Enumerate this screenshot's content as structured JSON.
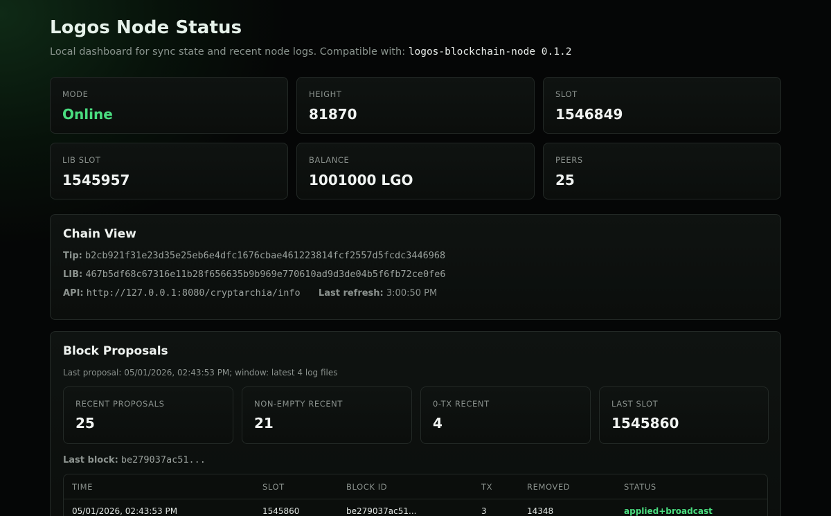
{
  "header": {
    "title": "Logos Node Status",
    "subtitle_text": "Local dashboard for sync state and recent node logs. Compatible with:",
    "compat_version": "logos-blockchain-node 0.1.2"
  },
  "stats": [
    {
      "label": "MODE",
      "value": "Online"
    },
    {
      "label": "HEIGHT",
      "value": "81870"
    },
    {
      "label": "SLOT",
      "value": "1546849"
    },
    {
      "label": "LIB SLOT",
      "value": "1545957"
    },
    {
      "label": "BALANCE",
      "value": "1001000 LGO"
    },
    {
      "label": "PEERS",
      "value": "25"
    }
  ],
  "chain_view": {
    "title": "Chain View",
    "tip_label": "Tip:",
    "tip": "b2cb921f31e23d35e25eb6e4dfc1676cbae461223814fcf2557d5fcdc3446968",
    "lib_label": "LIB:",
    "lib": "467b5df68c67316e11b28f656635b9b969e770610ad9d3de04b5f6fb72ce0fe6",
    "api_label": "API:",
    "api": "http://127.0.0.1:8080/cryptarchia/info",
    "refresh_label": "Last refresh:",
    "refresh": "3:00:50 PM"
  },
  "block_proposals": {
    "title": "Block Proposals",
    "meta": "Last proposal: 05/01/2026, 02:43:53 PM; window: latest 4 log files",
    "stats": [
      {
        "label": "RECENT PROPOSALS",
        "value": "25"
      },
      {
        "label": "NON-EMPTY RECENT",
        "value": "21"
      },
      {
        "label": "0-TX RECENT",
        "value": "4"
      },
      {
        "label": "LAST SLOT",
        "value": "1545860"
      }
    ],
    "last_block_label": "Last block:",
    "last_block": "be279037ac51...",
    "table": {
      "columns": [
        "TIME",
        "SLOT",
        "BLOCK ID",
        "TX",
        "REMOVED",
        "STATUS"
      ],
      "rows": [
        [
          "05/01/2026, 02:43:53 PM",
          "1545860",
          "be279037ac51...",
          "3",
          "14348",
          "applied+broadcast"
        ]
      ]
    }
  },
  "colors": {
    "accent_green": "#4ade80",
    "background": "#050606",
    "card": "#0d110f"
  }
}
